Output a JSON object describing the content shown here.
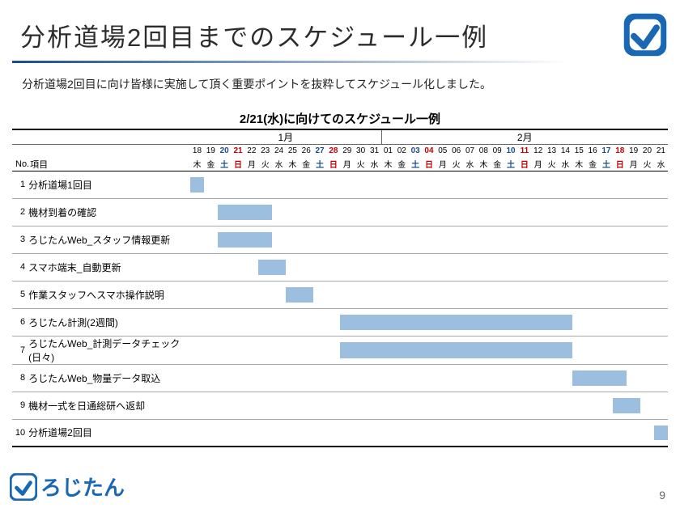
{
  "header": {
    "title": "分析道場2回目までのスケジュール一例"
  },
  "subtitle": "分析道場2回目に向け皆様に実施して頂く重要ポイントを抜粋してスケジュール化しました。",
  "table": {
    "col_no_label": "No.",
    "col_item_label": "項目"
  },
  "brand": {
    "text": "ろじたん"
  },
  "page_number": "9",
  "chart_data": {
    "type": "gantt",
    "title": "2/21(水)に向けてのスケジュール一例",
    "months": [
      {
        "label": "1月",
        "from": "1/18",
        "to": "1/31"
      },
      {
        "label": "2月",
        "from": "2/01",
        "to": "2/21"
      }
    ],
    "dates": [
      "18",
      "19",
      "20",
      "21",
      "22",
      "23",
      "24",
      "25",
      "26",
      "27",
      "28",
      "29",
      "30",
      "31",
      "01",
      "02",
      "03",
      "04",
      "05",
      "06",
      "07",
      "08",
      "09",
      "10",
      "11",
      "12",
      "13",
      "14",
      "15",
      "16",
      "17",
      "18",
      "19",
      "20",
      "21"
    ],
    "dow": [
      "木",
      "金",
      "土",
      "日",
      "月",
      "火",
      "水",
      "木",
      "金",
      "土",
      "日",
      "月",
      "火",
      "水",
      "木",
      "金",
      "土",
      "日",
      "月",
      "火",
      "水",
      "木",
      "金",
      "土",
      "日",
      "月",
      "火",
      "水",
      "木",
      "金",
      "土",
      "日",
      "月",
      "火",
      "水"
    ],
    "tasks": [
      {
        "no": 1,
        "name": "分析道場1回目",
        "start": 1,
        "end": 1
      },
      {
        "no": 2,
        "name": "機材到着の確認",
        "start": 3,
        "end": 6
      },
      {
        "no": 3,
        "name": "ろじたんWeb_スタッフ情報更新",
        "start": 3,
        "end": 6
      },
      {
        "no": 4,
        "name": "スマホ端末_自動更新",
        "start": 6,
        "end": 7
      },
      {
        "no": 5,
        "name": "作業スタッフへスマホ操作説明",
        "start": 8,
        "end": 9
      },
      {
        "no": 6,
        "name": "ろじたん計測(2週間)",
        "start": 12,
        "end": 28
      },
      {
        "no": 7,
        "name": "ろじたんWeb_計測データチェック(日々)",
        "start": 12,
        "end": 28
      },
      {
        "no": 8,
        "name": "ろじたんWeb_物量データ取込",
        "start": 29,
        "end": 32
      },
      {
        "no": 9,
        "name": "機材一式を日通総研へ返却",
        "start": 32,
        "end": 33
      },
      {
        "no": 10,
        "name": "分析道場2回目",
        "start": 35,
        "end": 35
      }
    ]
  }
}
